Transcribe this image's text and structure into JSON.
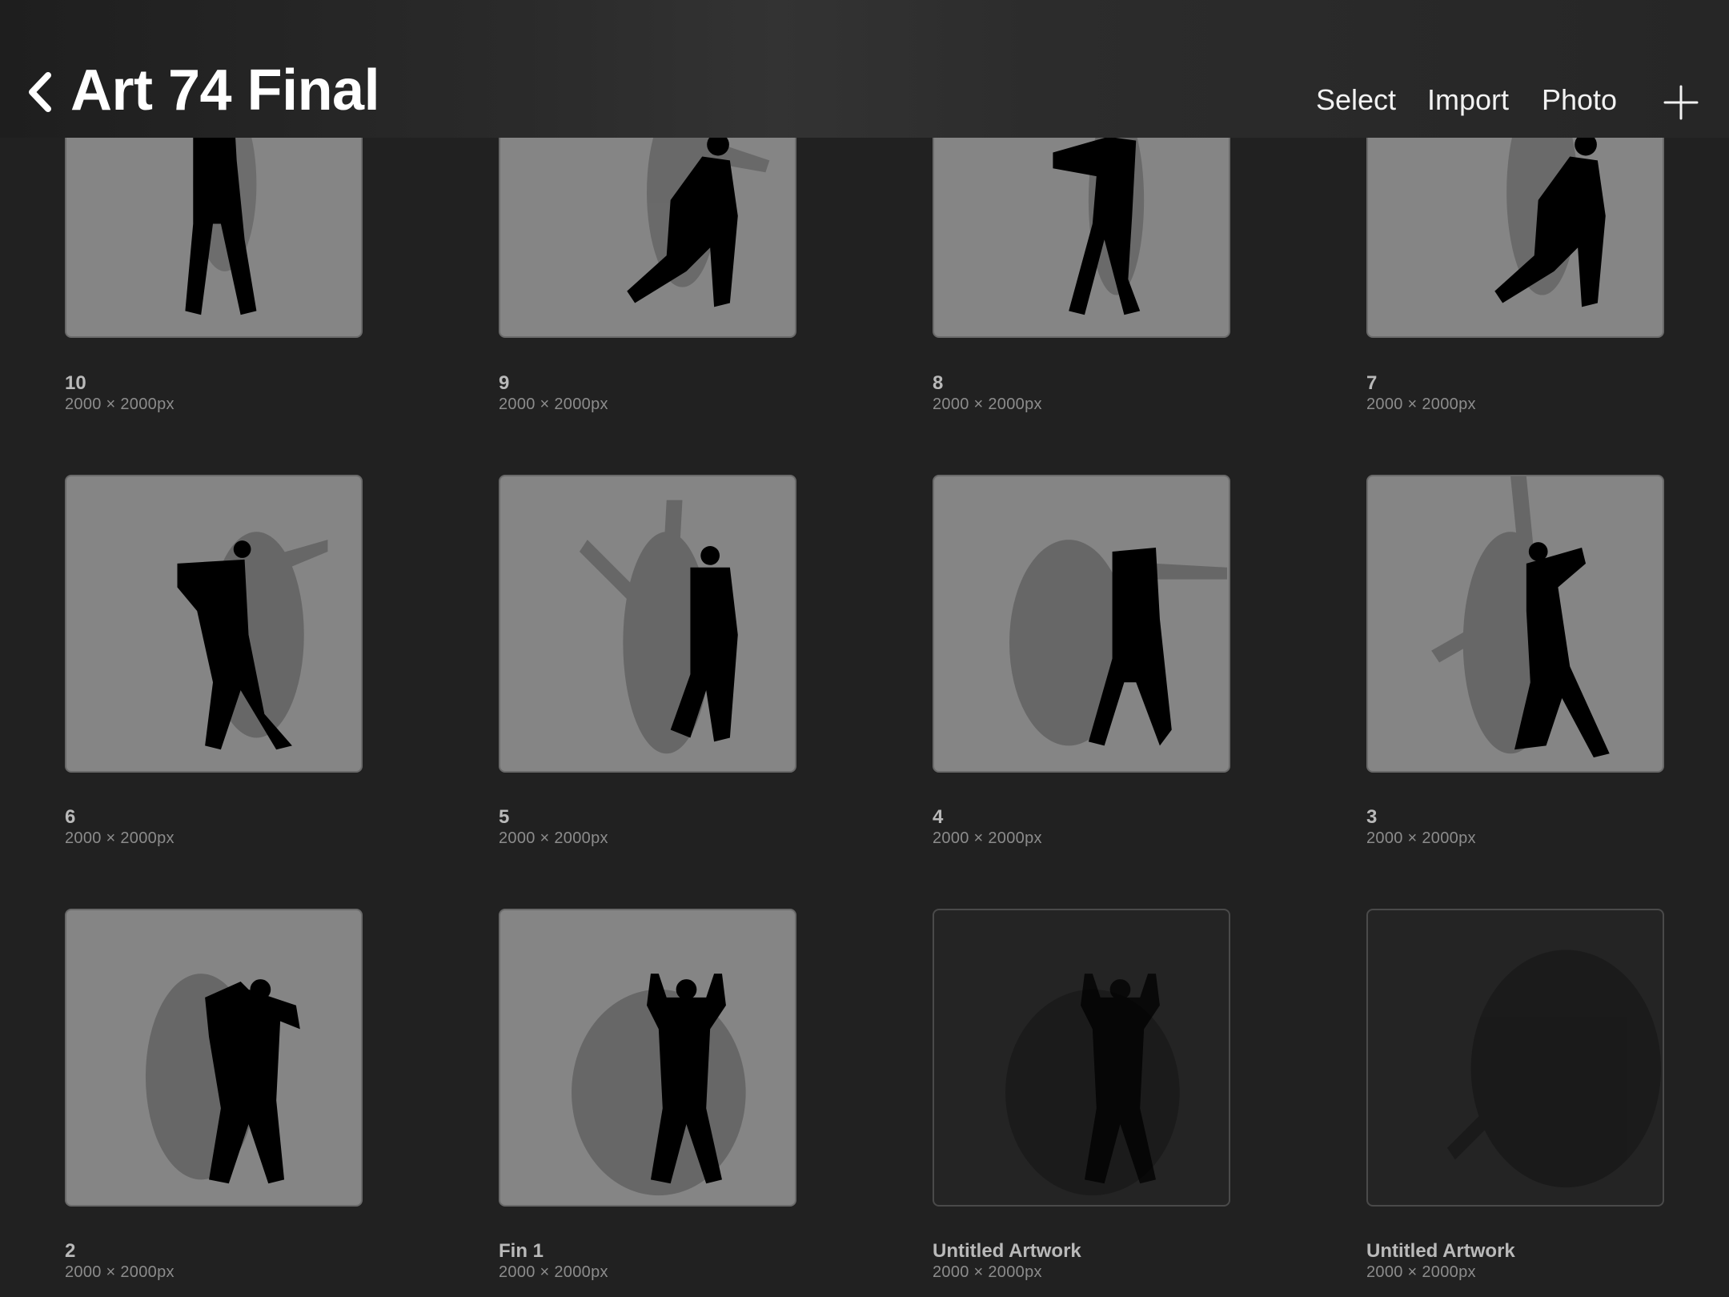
{
  "header": {
    "title": "Art 74 Final",
    "select_label": "Select",
    "import_label": "Import",
    "photo_label": "Photo"
  },
  "artworks": [
    {
      "name": "10",
      "dims": "2000 × 2000px"
    },
    {
      "name": "9",
      "dims": "2000 × 2000px"
    },
    {
      "name": "8",
      "dims": "2000 × 2000px"
    },
    {
      "name": "7",
      "dims": "2000 × 2000px"
    },
    {
      "name": "6",
      "dims": "2000 × 2000px"
    },
    {
      "name": "5",
      "dims": "2000 × 2000px"
    },
    {
      "name": "4",
      "dims": "2000 × 2000px"
    },
    {
      "name": "3",
      "dims": "2000 × 2000px"
    },
    {
      "name": "2",
      "dims": "2000 × 2000px"
    },
    {
      "name": "Fin 1",
      "dims": "2000 × 2000px"
    },
    {
      "name": "Untitled Artwork",
      "dims": "2000 × 2000px"
    },
    {
      "name": "Untitled Artwork",
      "dims": "2000 × 2000px"
    }
  ]
}
